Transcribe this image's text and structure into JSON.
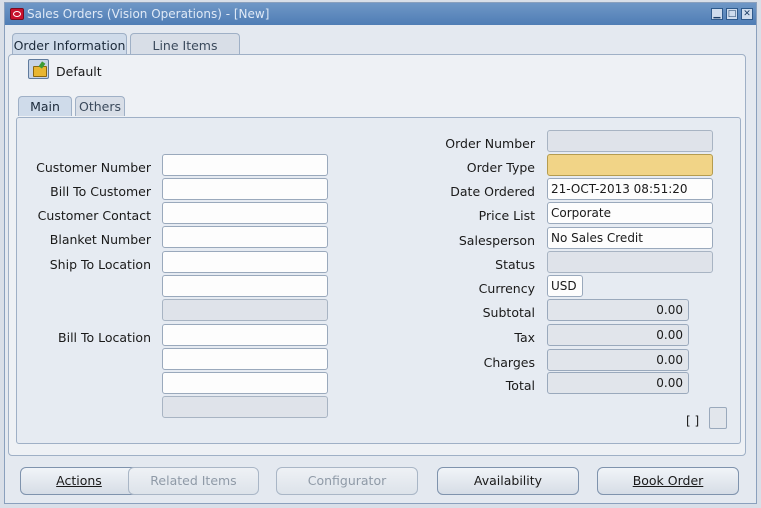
{
  "window": {
    "title": "Sales Orders (Vision Operations) - [New]",
    "controls": {
      "minimize": "▁",
      "maximize": "□",
      "close": "✕"
    }
  },
  "tabs": [
    {
      "label": "Order Information",
      "active": true
    },
    {
      "label": "Line Items",
      "active": false
    }
  ],
  "toolbar": {
    "default_label": "Default",
    "icon": "folder-open-icon"
  },
  "subtabs": [
    {
      "label": "Main",
      "active": true
    },
    {
      "label": "Others",
      "active": false
    }
  ],
  "left_fields": {
    "customer_number": {
      "label": "Customer Number",
      "value": ""
    },
    "bill_to_customer": {
      "label": "Bill To Customer",
      "value": ""
    },
    "customer_contact": {
      "label": "Customer Contact",
      "value": ""
    },
    "blanket_number": {
      "label": "Blanket Number",
      "value": ""
    },
    "ship_to_location": {
      "label": "Ship To Location",
      "value": ""
    },
    "bill_to_location": {
      "label": "Bill To Location",
      "value": ""
    }
  },
  "right_fields": {
    "order_number": {
      "label": "Order Number",
      "value": ""
    },
    "order_type": {
      "label": "Order Type",
      "value": ""
    },
    "date_ordered": {
      "label": "Date Ordered",
      "value": "21-OCT-2013 08:51:20"
    },
    "price_list": {
      "label": "Price List",
      "value": "Corporate"
    },
    "salesperson": {
      "label": "Salesperson",
      "value": "No Sales Credit"
    },
    "status": {
      "label": "Status",
      "value": ""
    },
    "currency": {
      "label": "Currency",
      "value": "USD"
    },
    "subtotal": {
      "label": "Subtotal",
      "value": "0.00"
    },
    "tax": {
      "label": "Tax",
      "value": "0.00"
    },
    "charges": {
      "label": "Charges",
      "value": "0.00"
    },
    "total": {
      "label": "Total",
      "value": "0.00"
    }
  },
  "bracket_indicator": "[ ]",
  "buttons": {
    "actions": {
      "label": "Actions",
      "enabled": true
    },
    "related_items": {
      "label": "Related Items",
      "enabled": false
    },
    "configurator": {
      "label": "Configurator",
      "enabled": false
    },
    "availability": {
      "label": "Availability",
      "enabled": true
    },
    "book_order": {
      "label": "Book Order",
      "enabled": true
    }
  },
  "colors": {
    "title_bar": "#4f7db5",
    "required_field": "#f1d487",
    "background": "#e4e9f0"
  }
}
